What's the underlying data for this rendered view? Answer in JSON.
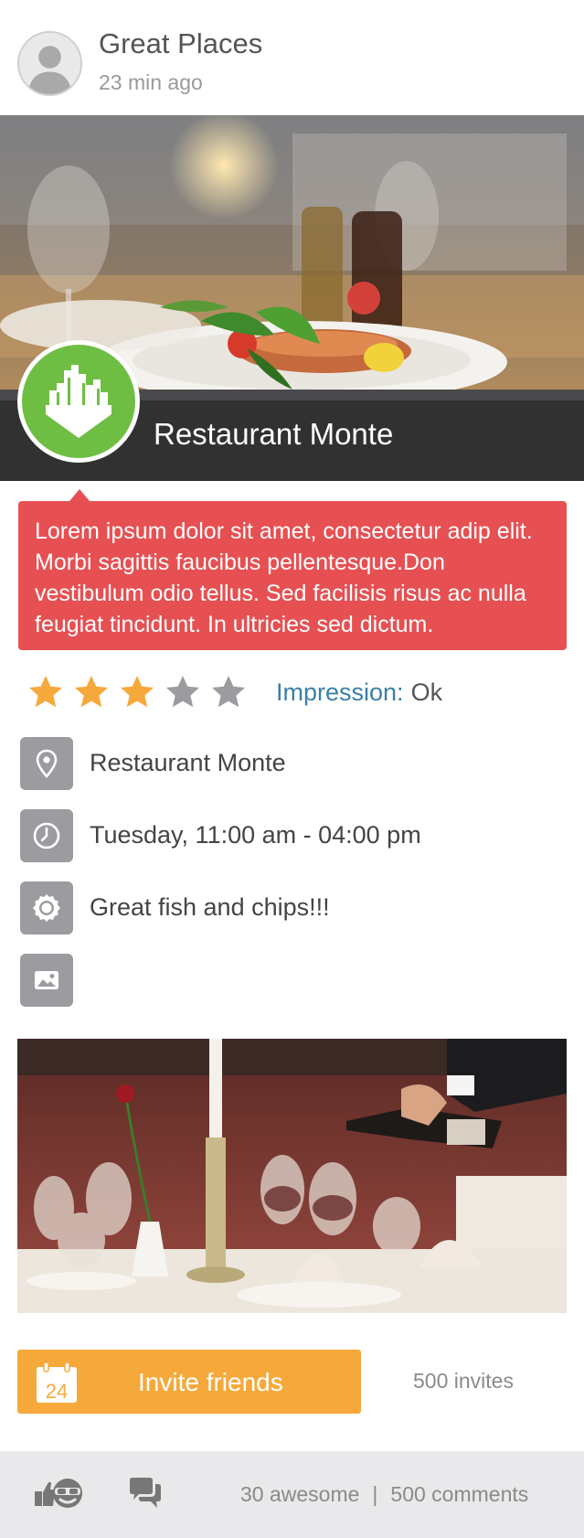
{
  "post": {
    "author": "Great Places",
    "time": "23 min ago",
    "hero_title": "Restaurant Monte",
    "description": "Lorem ipsum dolor sit amet, consectetur adip elit. Morbi sagittis faucibus pellentesque.Don vestibulum odio tellus. Sed facilisis risus ac nulla feugiat tincidunt. In ultricies sed dictum."
  },
  "rating": {
    "value": 3,
    "max": 5,
    "impression_label": "Impression:",
    "impression_value": "Ok",
    "colors": {
      "filled": "#f6a93b",
      "empty": "#9c9ca0"
    }
  },
  "details": {
    "location": {
      "icon": "location-pin-icon",
      "text": "Restaurant Monte"
    },
    "time": {
      "icon": "clock-icon",
      "text": "Tuesday, 11:00 am - 04:00 pm"
    },
    "comment": {
      "icon": "badge-icon",
      "text": "Great fish and chips!!!"
    },
    "photo": {
      "icon": "image-icon"
    }
  },
  "invite": {
    "button_label": "Invite friends",
    "calendar_day": "24",
    "count": "500 invites"
  },
  "footer": {
    "awesome": "30 awesome",
    "separator": "|",
    "comments": "500 comments"
  },
  "colors": {
    "accent_red": "#e65052",
    "accent_green": "#6fbe44",
    "accent_orange": "#f6a93b",
    "link_blue": "#3b7fa6"
  }
}
